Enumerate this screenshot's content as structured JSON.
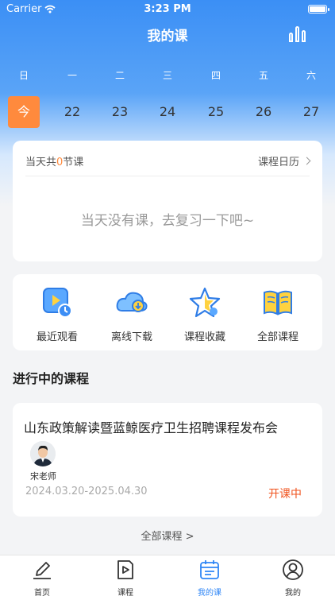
{
  "status_bar": {
    "carrier": "Carrier",
    "time": "3:23 PM"
  },
  "header": {
    "title": "我的课"
  },
  "calendar": {
    "weekdays": [
      "日",
      "一",
      "二",
      "三",
      "四",
      "五",
      "六"
    ],
    "dates": [
      "今",
      "22",
      "23",
      "24",
      "25",
      "26",
      "27"
    ]
  },
  "schedule": {
    "prefix": "当天共",
    "count": "0",
    "suffix": "节课",
    "calendar_link": "课程日历",
    "empty_text": "当天没有课，去复习一下吧~"
  },
  "quick_actions": [
    {
      "label": "最近观看",
      "icon": "recent-watch-icon"
    },
    {
      "label": "离线下载",
      "icon": "cloud-download-icon"
    },
    {
      "label": "课程收藏",
      "icon": "star-favorite-icon"
    },
    {
      "label": "全部课程",
      "icon": "book-icon"
    }
  ],
  "in_progress": {
    "section_title": "进行中的课程",
    "course": {
      "title": "山东政策解读暨蓝鲸医疗卫生招聘课程发布会",
      "teacher": "宋老师",
      "dates": "2024.03.20-2025.04.30",
      "status": "开课中"
    },
    "all_link": "全部课程 >"
  },
  "tabbar": [
    {
      "label": "首页",
      "icon": "pen-icon"
    },
    {
      "label": "课程",
      "icon": "video-icon"
    },
    {
      "label": "我的课",
      "icon": "calendar-icon"
    },
    {
      "label": "我的",
      "icon": "user-icon"
    }
  ],
  "colors": {
    "primary": "#2f86f6",
    "accent": "#ff8a3d",
    "status": "#f0531e"
  }
}
